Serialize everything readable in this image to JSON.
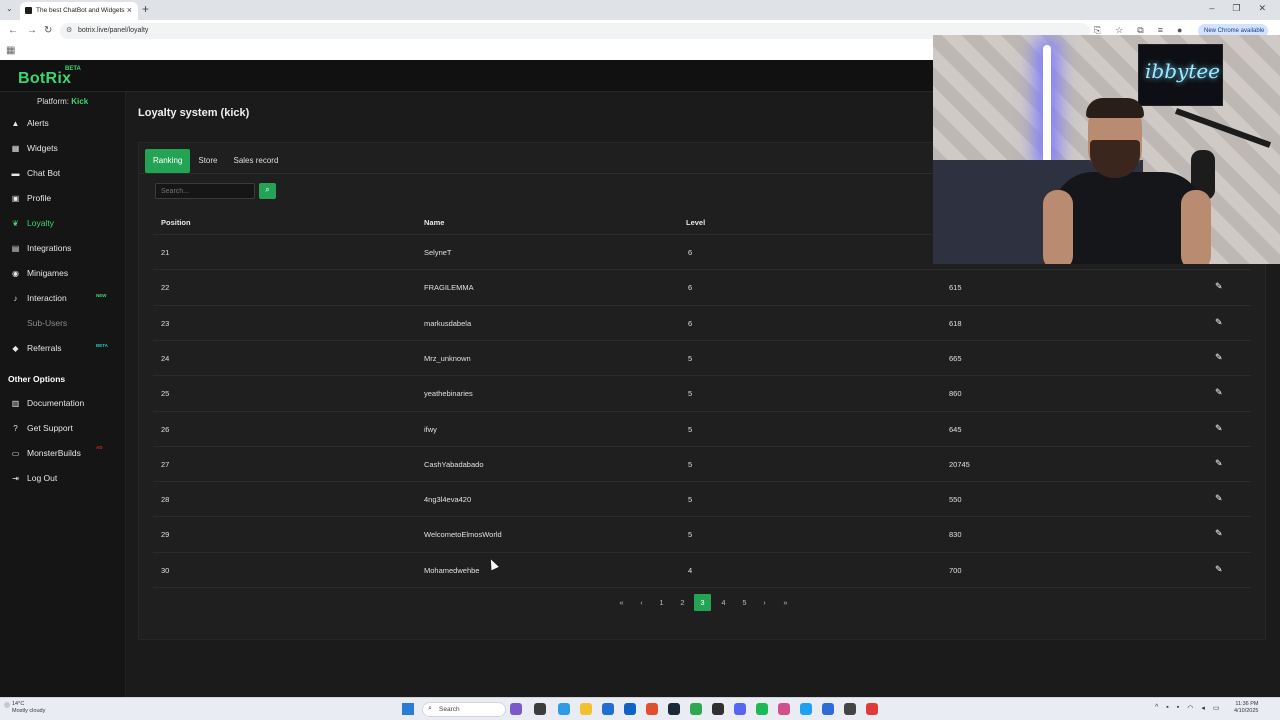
{
  "browser": {
    "tab_title": "The best ChatBot and Widgets",
    "url": "botrix.live/panel/loyalty",
    "update_label": "New Chrome available"
  },
  "header": {
    "logo": "BotRix",
    "beta": "BETA"
  },
  "sidebar": {
    "platform_label": "Platform:",
    "platform_value": "Kick",
    "items": [
      {
        "label": "Alerts",
        "icon": "triangle-warning-icon"
      },
      {
        "label": "Widgets",
        "icon": "grid-icon"
      },
      {
        "label": "Chat Bot",
        "icon": "chat-icon"
      },
      {
        "label": "Profile",
        "icon": "id-card-icon"
      },
      {
        "label": "Loyalty",
        "icon": "leaf-icon"
      },
      {
        "label": "Integrations",
        "icon": "plug-icon"
      },
      {
        "label": "Minigames",
        "icon": "gamepad-icon"
      },
      {
        "label": "Interaction",
        "icon": "music-icon",
        "badge": "NEW"
      },
      {
        "label": "Sub-Users",
        "icon": "sub-users-icon"
      },
      {
        "label": "Referrals",
        "icon": "users-icon",
        "badge": "BETA"
      }
    ],
    "other_options_title": "Other Options",
    "other_items": [
      {
        "label": "Documentation",
        "icon": "book-icon"
      },
      {
        "label": "Get Support",
        "icon": "help-icon"
      },
      {
        "label": "MonsterBuilds",
        "icon": "laptop-icon",
        "badge": "AD"
      },
      {
        "label": "Log Out",
        "icon": "logout-icon"
      }
    ]
  },
  "main": {
    "title": "Loyalty system (kick)",
    "tabs": [
      "Ranking",
      "Store",
      "Sales record"
    ],
    "search_placeholder": "Search...",
    "columns": [
      "Position",
      "Name",
      "Level"
    ],
    "rows": [
      {
        "position": "21",
        "name": "SelyneT",
        "level": "6",
        "points": ""
      },
      {
        "position": "22",
        "name": "FRAGILEMMA",
        "level": "6",
        "points": "615"
      },
      {
        "position": "23",
        "name": "markusdabela",
        "level": "6",
        "points": "618"
      },
      {
        "position": "24",
        "name": "Mrz_unknown",
        "level": "5",
        "points": "665"
      },
      {
        "position": "25",
        "name": "yeathebinaries",
        "level": "5",
        "points": "860"
      },
      {
        "position": "26",
        "name": "ifwy",
        "level": "5",
        "points": "645"
      },
      {
        "position": "27",
        "name": "CashYabadabado",
        "level": "5",
        "points": "20745"
      },
      {
        "position": "28",
        "name": "4ng3l4eva420",
        "level": "5",
        "points": "550"
      },
      {
        "position": "29",
        "name": "WelcometoElmosWorld",
        "level": "5",
        "points": "830"
      },
      {
        "position": "30",
        "name": "Mohamedwehbe",
        "level": "4",
        "points": "700"
      }
    ],
    "pagination": {
      "first": "«",
      "prev": "‹",
      "pages": [
        "1",
        "2",
        "3",
        "4",
        "5"
      ],
      "current": "3",
      "next": "›",
      "last": "»"
    }
  },
  "webcam": {
    "sign_text": "ibbytee"
  },
  "taskbar": {
    "weather_temp": "14°C",
    "weather_desc": "Mostly cloudy",
    "search_label": "Search",
    "time": "11:36 PM",
    "date": "4/10/2025"
  }
}
